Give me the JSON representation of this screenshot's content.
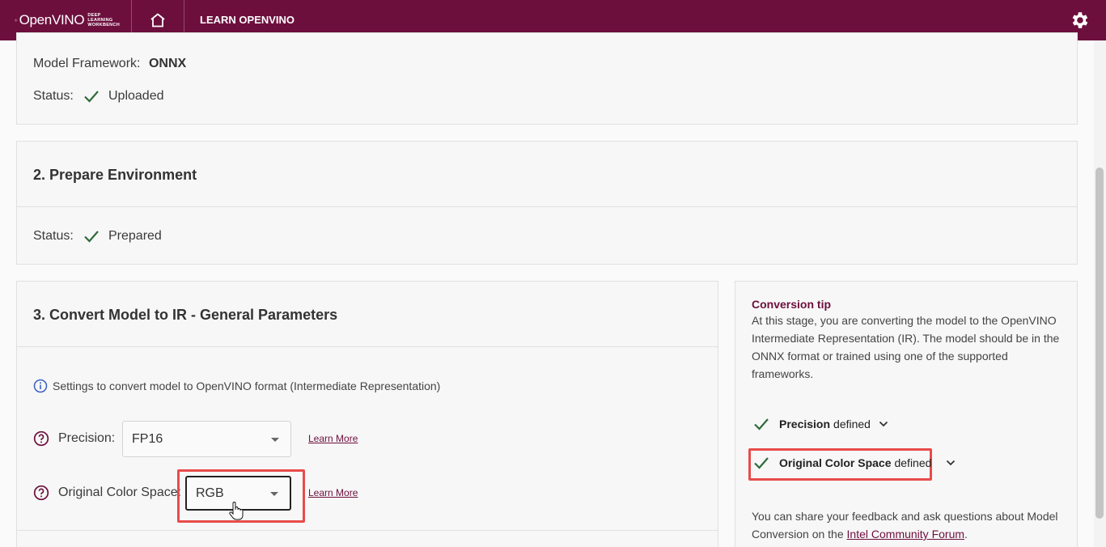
{
  "header": {
    "logo_text": "OpenVINO",
    "logo_sub_line1": "DEEP LEARNING",
    "logo_sub_line2": "WORKBENCH",
    "learn_label": "LEARN OPENVINO",
    "home_icon": "home-icon",
    "settings_icon": "gear-icon",
    "bg_color": "#6d0f3d"
  },
  "model_card": {
    "framework_label": "Model Framework:",
    "framework_value": "ONNX",
    "status_label": "Status:",
    "status_value": "Uploaded"
  },
  "env_card": {
    "title": "2. Prepare Environment",
    "status_label": "Status:",
    "status_value": "Prepared"
  },
  "convert_card": {
    "title": "3. Convert Model to IR - General Parameters",
    "info_text": "Settings to convert model to OpenVINO format (Intermediate Representation)",
    "precision_label": "Precision:",
    "precision_value": "FP16",
    "color_space_label": "Original Color Space:",
    "color_space_value": "RGB",
    "learn_more": "Learn More"
  },
  "tip_card": {
    "title": "Conversion tip",
    "body": "At this stage, you are converting the model to the OpenVINO Intermediate Representation (IR). The model should be in the ONNX format or trained using one of the supported frameworks.",
    "precision_name": "Precision",
    "color_space_name": "Original Color Space",
    "defined_word": "defined",
    "feedback_text": "You can share your feedback and ask questions about Model Conversion on the",
    "forum_link": "Intel Community Forum",
    "period": "."
  },
  "colors": {
    "accent": "#6d0f3d",
    "check": "#2e6b3a",
    "highlight": "#e84b4b",
    "info": "#3b5fc0"
  }
}
